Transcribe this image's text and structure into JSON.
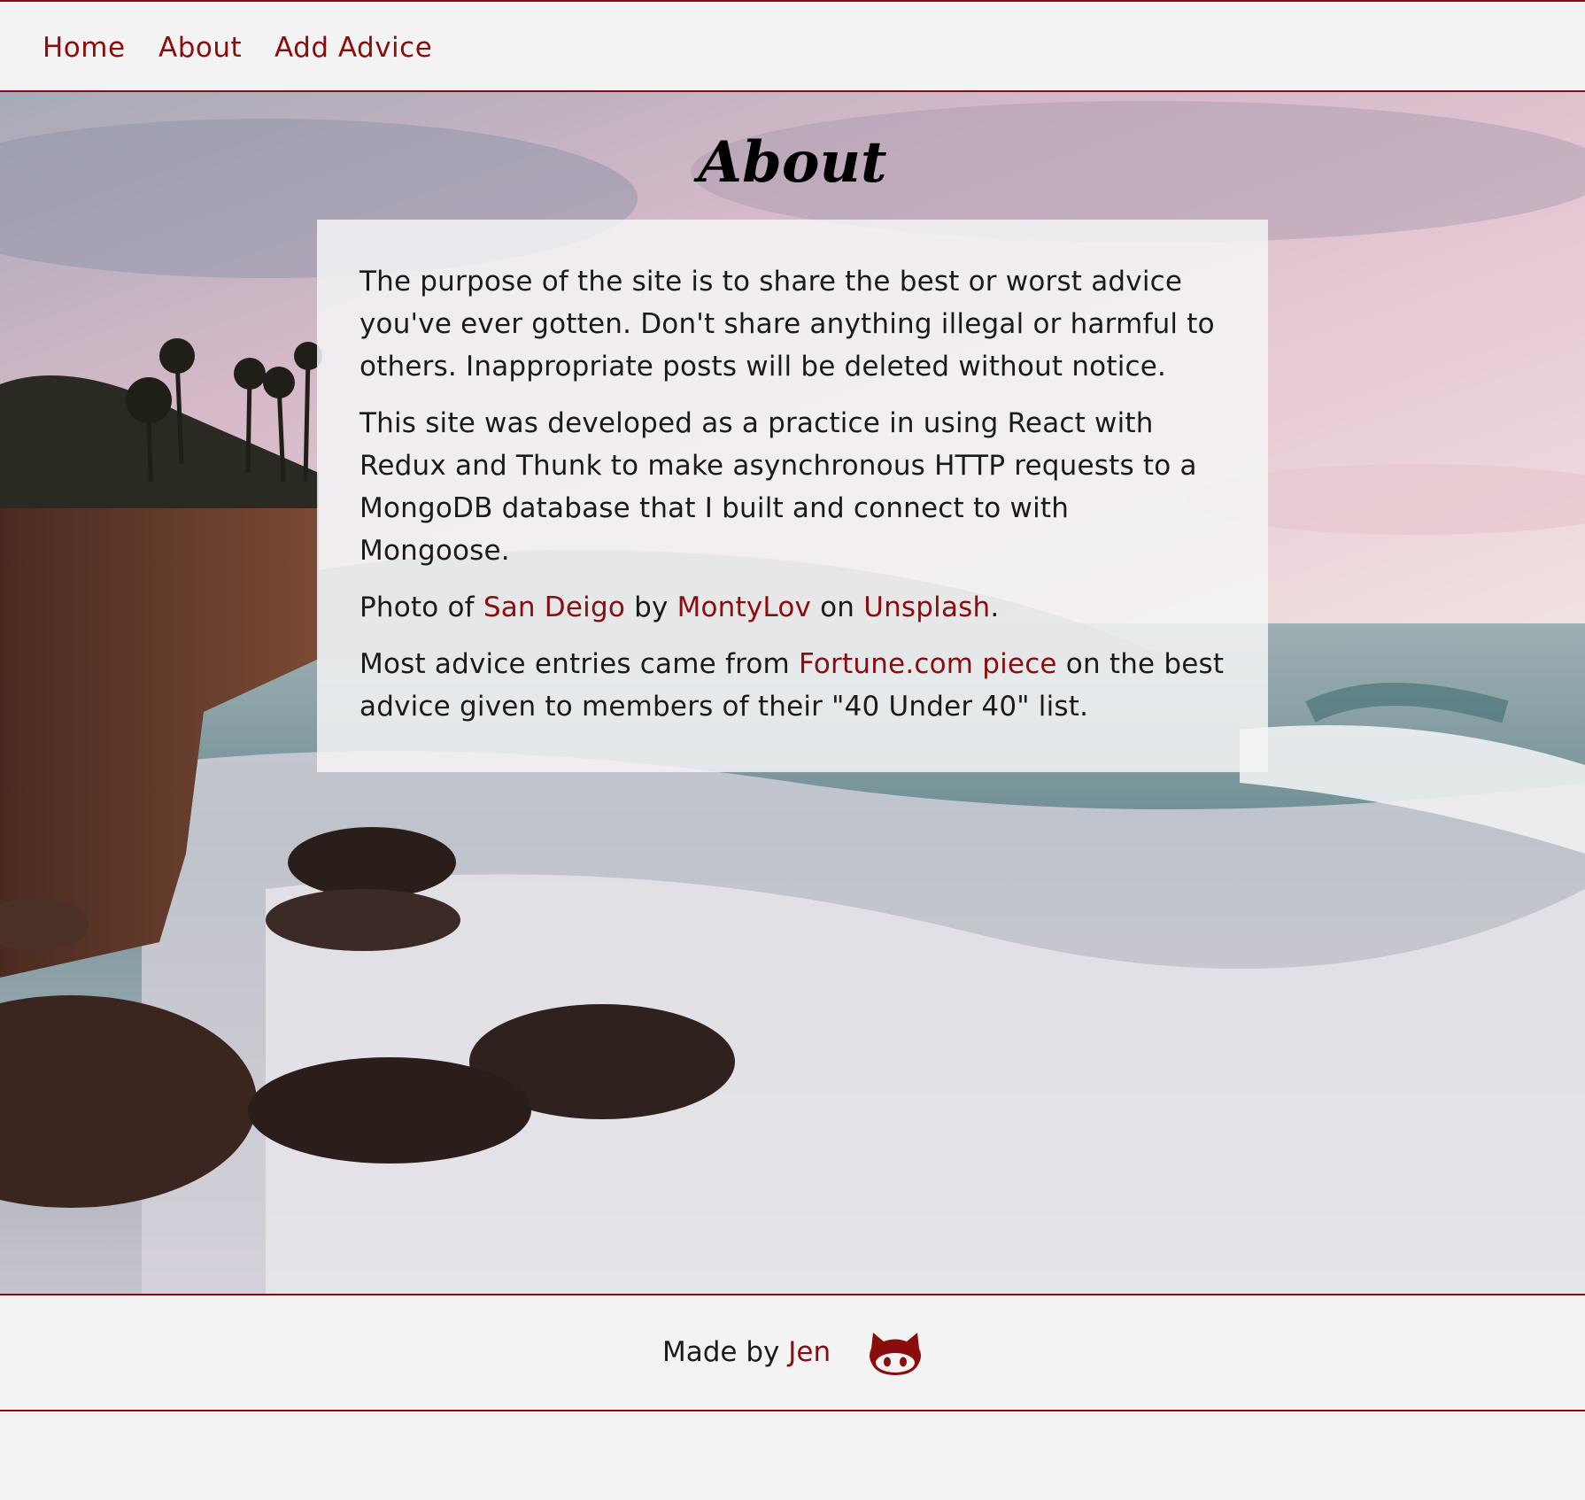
{
  "nav": {
    "home": "Home",
    "about": "About",
    "add_advice": "Add Advice"
  },
  "page": {
    "title": "About"
  },
  "content": {
    "p1": "The purpose of the site is to share the best or worst advice you've ever gotten. Don't share anything illegal or harmful to others. Inappropriate posts will be deleted without notice.",
    "p2": "This site was developed as a practice in using React with Redux and Thunk to make asynchronous HTTP requests to a MongoDB database that I built and connect to with Mongoose.",
    "p3": {
      "prefix": "Photo of ",
      "link1": "San Deigo",
      "mid1": " by ",
      "link2": "MontyLov",
      "mid2": " on ",
      "link3": "Unsplash",
      "suffix": "."
    },
    "p4": {
      "prefix": "Most advice entries came from ",
      "link": "Fortune.com piece",
      "suffix": " on the best advice given to members of their \"40 Under 40\" list."
    }
  },
  "footer": {
    "made_by": "Made by ",
    "author": "Jen",
    "github_icon": "github-octocat-icon"
  },
  "colors": {
    "accent": "#8b0c0c",
    "background": "#f4f3f3",
    "text": "#1a1a1a"
  }
}
